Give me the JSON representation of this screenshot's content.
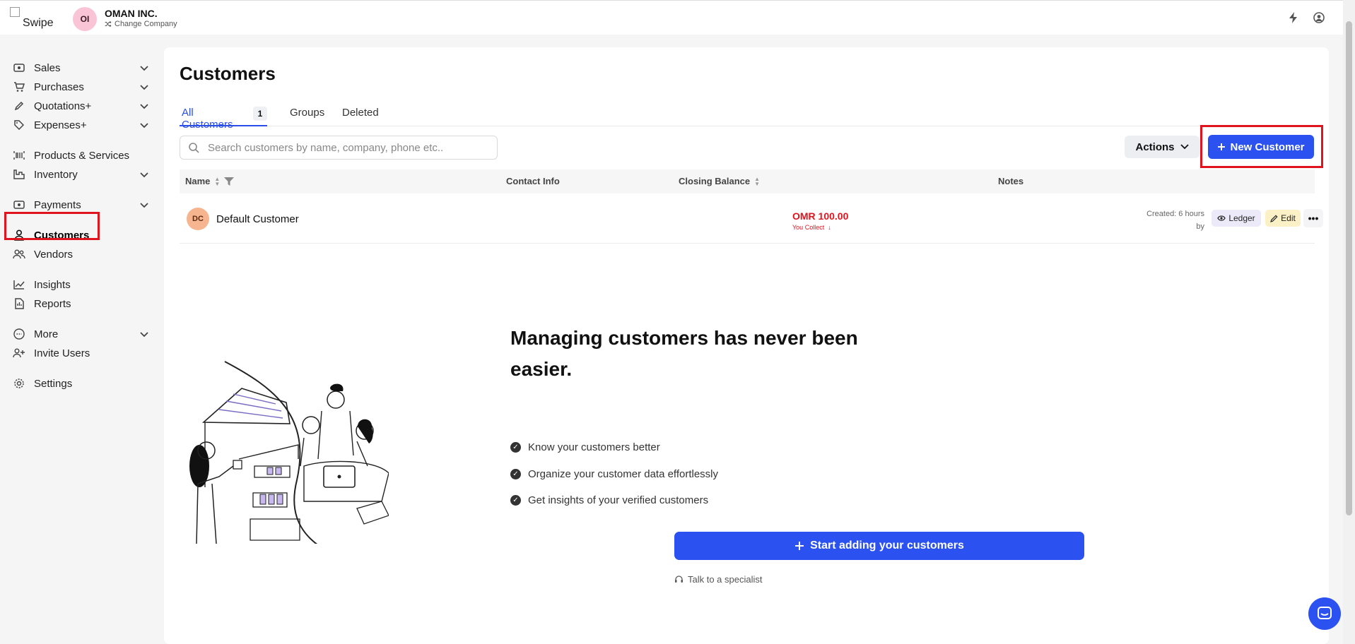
{
  "topbar": {
    "logo_alt": "Swipe",
    "company_initials": "OI",
    "company_name": "OMAN INC.",
    "change_company": "Change Company"
  },
  "sidebar": {
    "items": [
      {
        "label": "Sales",
        "icon": "cash-icon",
        "chevron": true
      },
      {
        "label": "Purchases",
        "icon": "cart-icon",
        "chevron": true
      },
      {
        "label": "Quotations+",
        "icon": "pen-icon",
        "chevron": true
      },
      {
        "label": "Expenses+",
        "icon": "tag-icon",
        "chevron": true
      },
      {
        "label": "Products & Services",
        "icon": "barcode-icon",
        "chevron": false
      },
      {
        "label": "Inventory",
        "icon": "warehouse-icon",
        "chevron": true
      },
      {
        "label": "Payments",
        "icon": "money-icon",
        "chevron": true
      },
      {
        "label": "Customers",
        "icon": "user-icon",
        "chevron": false,
        "active": true
      },
      {
        "label": "Vendors",
        "icon": "users-icon",
        "chevron": false
      },
      {
        "label": "Insights",
        "icon": "chart-icon",
        "chevron": false
      },
      {
        "label": "Reports",
        "icon": "report-icon",
        "chevron": false
      },
      {
        "label": "More",
        "icon": "more-circle-icon",
        "chevron": true
      },
      {
        "label": "Invite Users",
        "icon": "user-plus-icon",
        "chevron": false
      },
      {
        "label": "Settings",
        "icon": "gear-icon",
        "chevron": false
      }
    ]
  },
  "main": {
    "title": "Customers",
    "tabs": [
      {
        "label": "All Customers",
        "count": "1"
      },
      {
        "label": "Groups"
      },
      {
        "label": "Deleted"
      }
    ],
    "search_placeholder": "Search customers by name, company, phone etc..",
    "actions_label": "Actions",
    "new_customer_label": "New Customer",
    "table": {
      "headers": {
        "name": "Name",
        "contact": "Contact Info",
        "balance": "Closing Balance",
        "notes": "Notes"
      },
      "rows": [
        {
          "initials": "DC",
          "name": "Default Customer",
          "balance": "OMR 100.00",
          "balance_note": "You Collect",
          "created_line1": "Created: 6 hours",
          "created_line2": "by",
          "ledger_label": "Ledger",
          "edit_label": "Edit"
        }
      ]
    },
    "empty_state": {
      "title": "Managing customers has never been easier.",
      "bullets": [
        "Know your customers better",
        "Organize your customer data effortlessly",
        "Get insights of your verified customers"
      ],
      "cta_label": "Start adding your customers",
      "talk_label": "Talk to a specialist"
    }
  },
  "colors": {
    "accent": "#2b51f0",
    "negative": "#e0141e",
    "highlight": "#e0141e"
  }
}
